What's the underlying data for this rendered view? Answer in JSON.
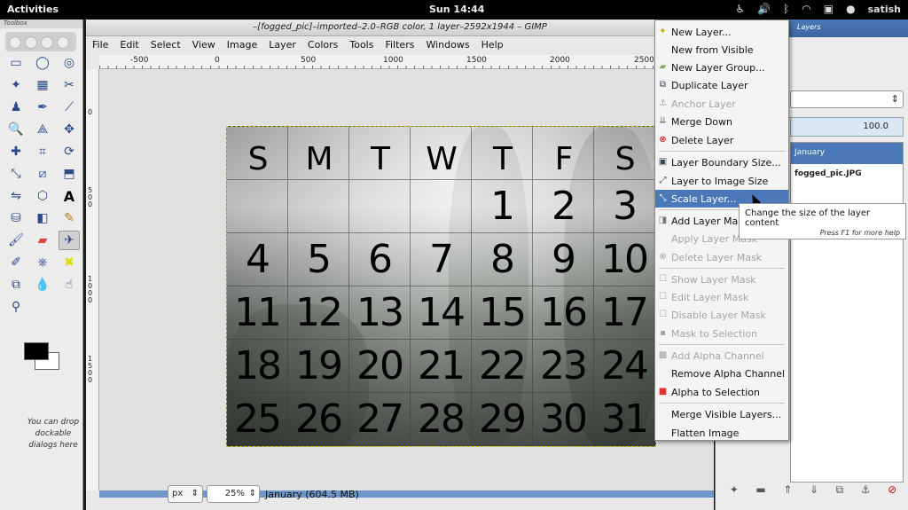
{
  "topbar": {
    "activities": "Activities",
    "clock": "Sun 14:44",
    "user": "satish",
    "tray_icons": [
      "accessibility-icon",
      "volume-icon",
      "bluetooth-icon",
      "wifi-icon",
      "clipboard-icon",
      "user-icon"
    ]
  },
  "toolbox": {
    "title": "Toolbox",
    "drop_hint": "You can drop dockable dialogs here",
    "fg_color": "#000000",
    "bg_color": "#ffffff"
  },
  "window": {
    "title": "–[fogged_pic]–imported–2.0–RGB color, 1 layer–2592x1944 – GIMP"
  },
  "menubar": [
    "File",
    "Edit",
    "Select",
    "View",
    "Image",
    "Layer",
    "Colors",
    "Tools",
    "Filters",
    "Windows",
    "Help"
  ],
  "ruler_h_labels": [
    "-500",
    "0",
    "500",
    "1000",
    "1500",
    "2000",
    "2500"
  ],
  "ruler_v_labels": [
    "0",
    "500",
    "1000",
    "1500"
  ],
  "calendar": {
    "days": [
      "S",
      "M",
      "T",
      "W",
      "T",
      "F",
      "S"
    ],
    "rows": [
      [
        "",
        "",
        "",
        "",
        "1",
        "2",
        "3"
      ],
      [
        "4",
        "5",
        "6",
        "7",
        "8",
        "9",
        "10"
      ],
      [
        "11",
        "12",
        "13",
        "14",
        "15",
        "16",
        "17"
      ],
      [
        "18",
        "19",
        "20",
        "21",
        "22",
        "23",
        "24"
      ],
      [
        "25",
        "26",
        "27",
        "28",
        "29",
        "30",
        "31"
      ]
    ]
  },
  "statusbar": {
    "unit": "px",
    "zoom": "25%",
    "info": "January (604.5 MB)"
  },
  "layer_menu": {
    "items": [
      {
        "label": "New Layer...",
        "enabled": true
      },
      {
        "label": "New from Visible",
        "enabled": true
      },
      {
        "label": "New Layer Group...",
        "enabled": true
      },
      {
        "label": "Duplicate Layer",
        "enabled": true
      },
      {
        "label": "Anchor Layer",
        "enabled": false
      },
      {
        "label": "Merge Down",
        "enabled": true
      },
      {
        "label": "Delete Layer",
        "enabled": true
      },
      {
        "label": "Layer Boundary Size...",
        "enabled": true
      },
      {
        "label": "Layer to Image Size",
        "enabled": true
      },
      {
        "label": "Scale Layer...",
        "enabled": true,
        "highlighted": true
      },
      {
        "label": "Add Layer Mask...",
        "enabled": true
      },
      {
        "label": "Apply Layer Mask",
        "enabled": false
      },
      {
        "label": "Delete Layer Mask",
        "enabled": false
      },
      {
        "label": "Show Layer Mask",
        "enabled": false
      },
      {
        "label": "Edit Layer Mask",
        "enabled": false
      },
      {
        "label": "Disable Layer Mask",
        "enabled": false
      },
      {
        "label": "Mask to Selection",
        "enabled": false
      },
      {
        "label": "Add Alpha Channel",
        "enabled": false
      },
      {
        "label": "Remove Alpha Channel",
        "enabled": true
      },
      {
        "label": "Alpha to Selection",
        "enabled": true
      },
      {
        "label": "Merge Visible Layers...",
        "enabled": true
      },
      {
        "label": "Flatten Image",
        "enabled": true
      }
    ]
  },
  "tooltip": {
    "main": "Change the size of the layer content",
    "help": "Press F1 for more help"
  },
  "layers_dock": {
    "title": "Layers",
    "opacity": "100.0",
    "layers": [
      "January",
      "fogged_pic.JPG"
    ]
  },
  "colors": {
    "selection": "#4a78b8",
    "scrollbar": "#6e96c8"
  }
}
